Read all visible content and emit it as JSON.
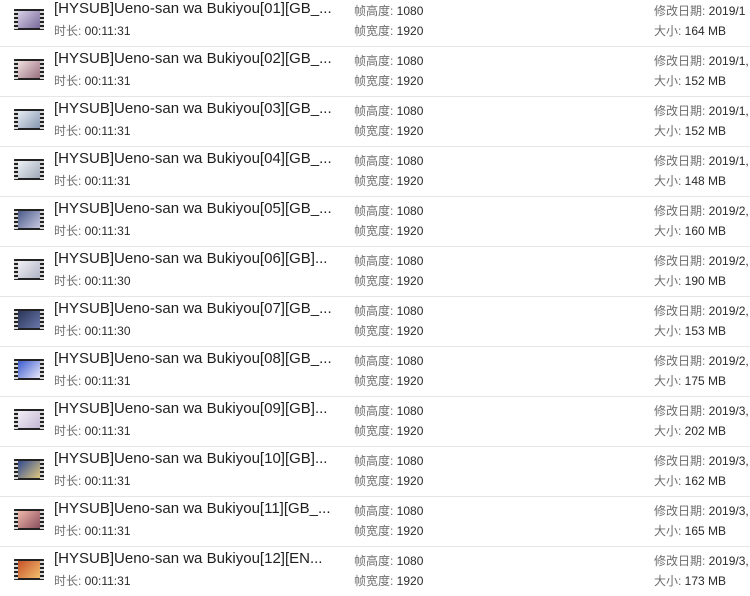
{
  "labels": {
    "duration": "时长: ",
    "frame_height": "帧高度: ",
    "frame_width": "帧宽度: ",
    "modified": "修改日期: ",
    "size": "大小: "
  },
  "files": [
    {
      "name": "[HYSUB]Ueno-san wa Bukiyou[01][GB_...",
      "duration": "00:11:31",
      "frame_height": "1080",
      "frame_width": "1920",
      "modified": "2019/1",
      "size": "164 MB",
      "icon": "video-thumbnail-icon",
      "thumb_colors": [
        "#d8d0e8",
        "#7a6a9a"
      ]
    },
    {
      "name": "[HYSUB]Ueno-san wa Bukiyou[02][GB_...",
      "duration": "00:11:31",
      "frame_height": "1080",
      "frame_width": "1920",
      "modified": "2019/1,",
      "size": "152 MB",
      "icon": "video-thumbnail-icon",
      "thumb_colors": [
        "#f0e0e0",
        "#9a7080"
      ]
    },
    {
      "name": "[HYSUB]Ueno-san wa Bukiyou[03][GB_...",
      "duration": "00:11:31",
      "frame_height": "1080",
      "frame_width": "1920",
      "modified": "2019/1,",
      "size": "152 MB",
      "icon": "video-thumbnail-icon",
      "thumb_colors": [
        "#e6ecf4",
        "#8898b0"
      ]
    },
    {
      "name": "[HYSUB]Ueno-san wa Bukiyou[04][GB_...",
      "duration": "00:11:31",
      "frame_height": "1080",
      "frame_width": "1920",
      "modified": "2019/1,",
      "size": "148 MB",
      "icon": "video-thumbnail-icon",
      "thumb_colors": [
        "#eef2f6",
        "#a0aab8"
      ]
    },
    {
      "name": "[HYSUB]Ueno-san wa Bukiyou[05][GB_...",
      "duration": "00:11:31",
      "frame_height": "1080",
      "frame_width": "1920",
      "modified": "2019/2,",
      "size": "160 MB",
      "icon": "video-thumbnail-icon",
      "thumb_colors": [
        "#4a5a8a",
        "#c8c8e0"
      ]
    },
    {
      "name": "[HYSUB]Ueno-san wa Bukiyou[06][GB]...",
      "duration": "00:11:30",
      "frame_height": "1080",
      "frame_width": "1920",
      "modified": "2019/2,",
      "size": "190 MB",
      "icon": "video-thumbnail-icon",
      "thumb_colors": [
        "#f0f0f4",
        "#b0b4c4"
      ]
    },
    {
      "name": "[HYSUB]Ueno-san wa Bukiyou[07][GB_...",
      "duration": "00:11:30",
      "frame_height": "1080",
      "frame_width": "1920",
      "modified": "2019/2,",
      "size": "153 MB",
      "icon": "video-thumbnail-icon",
      "thumb_colors": [
        "#2a3458",
        "#6a78a8"
      ]
    },
    {
      "name": "[HYSUB]Ueno-san wa Bukiyou[08][GB_...",
      "duration": "00:11:31",
      "frame_height": "1080",
      "frame_width": "1920",
      "modified": "2019/2,",
      "size": "175 MB",
      "icon": "video-thumbnail-icon",
      "thumb_colors": [
        "#3a5ad0",
        "#e8e8f8"
      ]
    },
    {
      "name": "[HYSUB]Ueno-san wa Bukiyou[09][GB]...",
      "duration": "00:11:31",
      "frame_height": "1080",
      "frame_width": "1920",
      "modified": "2019/3,",
      "size": "202 MB",
      "icon": "video-thumbnail-icon",
      "thumb_colors": [
        "#f2eef6",
        "#c4b8d4"
      ]
    },
    {
      "name": "[HYSUB]Ueno-san wa Bukiyou[10][GB]...",
      "duration": "00:11:31",
      "frame_height": "1080",
      "frame_width": "1920",
      "modified": "2019/3,",
      "size": "162 MB",
      "icon": "video-thumbnail-icon",
      "thumb_colors": [
        "#304a90",
        "#e0c880"
      ]
    },
    {
      "name": "[HYSUB]Ueno-san wa Bukiyou[11][GB_...",
      "duration": "00:11:31",
      "frame_height": "1080",
      "frame_width": "1920",
      "modified": "2019/3,",
      "size": "165 MB",
      "icon": "video-thumbnail-icon",
      "thumb_colors": [
        "#f0b8a8",
        "#8a5060"
      ]
    },
    {
      "name": "[HYSUB]Ueno-san wa Bukiyou[12][EN...",
      "duration": "00:11:31",
      "frame_height": "1080",
      "frame_width": "1920",
      "modified": "2019/3,",
      "size": "173 MB",
      "icon": "video-thumbnail-icon",
      "thumb_colors": [
        "#c85028",
        "#f0c070"
      ]
    }
  ]
}
